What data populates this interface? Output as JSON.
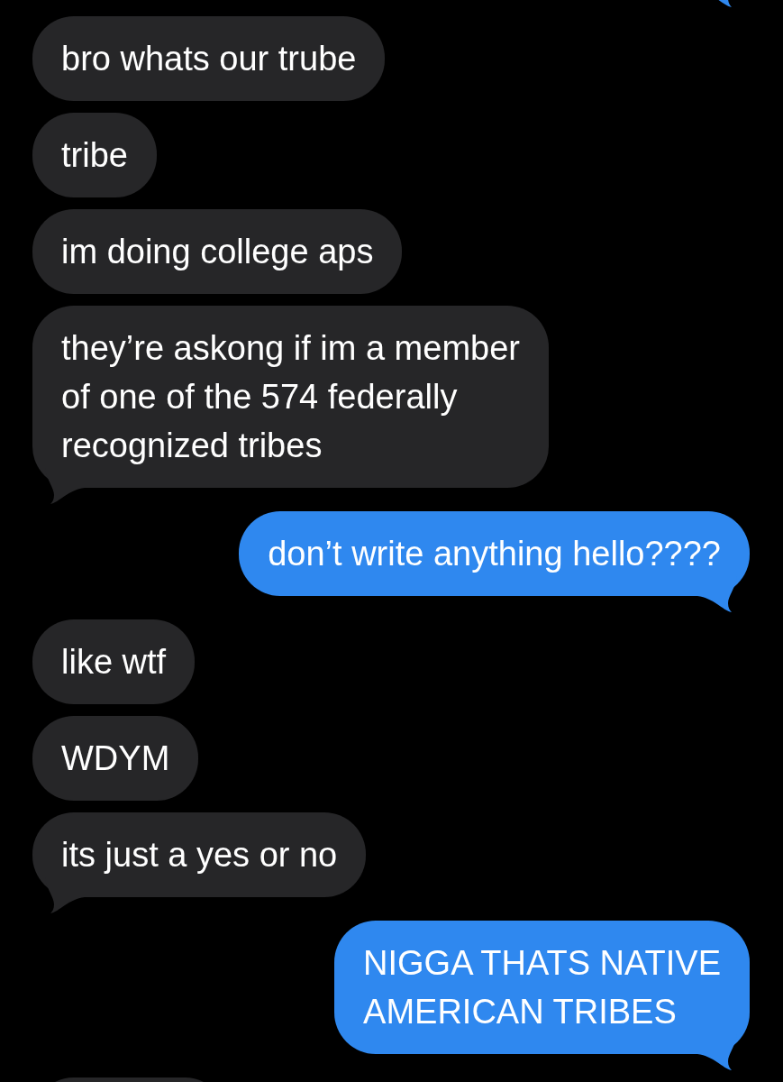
{
  "messages": [
    {
      "kind": "outgoing",
      "tail": true,
      "cut_off": true
    },
    {
      "kind": "incoming",
      "tail": false,
      "cut_off": false,
      "lines": [
        "bro whats our trube"
      ]
    },
    {
      "kind": "incoming",
      "tail": false,
      "cut_off": false,
      "lines": [
        "tribe"
      ]
    },
    {
      "kind": "incoming",
      "tail": false,
      "cut_off": false,
      "lines": [
        "im doing college aps"
      ]
    },
    {
      "kind": "incoming",
      "tail": true,
      "cut_off": false,
      "lines": [
        "they’re askong if im a member",
        "of one of the 574 federally",
        "recognized tribes"
      ]
    },
    {
      "kind": "outgoing",
      "tail": true,
      "cut_off": false,
      "lines": [
        "don’t write anything hello????"
      ]
    },
    {
      "kind": "incoming",
      "tail": false,
      "cut_off": false,
      "lines": [
        "like wtf"
      ]
    },
    {
      "kind": "incoming",
      "tail": false,
      "cut_off": false,
      "lines": [
        "WDYM"
      ]
    },
    {
      "kind": "incoming",
      "tail": true,
      "cut_off": false,
      "lines": [
        "its just a yes or no"
      ]
    },
    {
      "kind": "outgoing",
      "tail": true,
      "cut_off": false,
      "lines": [
        "NIGGA THATS NATIVE",
        "AMERICAN TRIBES"
      ]
    },
    {
      "kind": "incoming",
      "cut_off": true
    }
  ]
}
